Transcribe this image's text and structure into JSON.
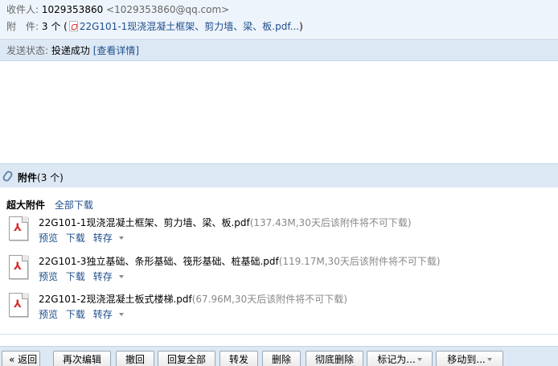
{
  "header": {
    "recipient_label": "收件人:",
    "recipient_name": "1029353860",
    "recipient_addr": "<1029353860@qq.com>",
    "attachment_label": "附　件:",
    "attachment_count": "3 个",
    "attachment_open": "(",
    "attachment_first": "22G101-1现浇混凝土框架、剪力墙、梁、板.pdf...",
    "attachment_close": ")"
  },
  "status": {
    "label": "发送状态:",
    "value": "投递成功",
    "detail_link": "[查看详情]"
  },
  "attachments": {
    "title": "附件",
    "count": "(3 个)",
    "section_label": "超大附件",
    "download_all": "全部下载",
    "items": [
      {
        "name": "22G101-1现浇混凝土框架、剪力墙、梁、板.pdf",
        "meta": "(137.43M,30天后该附件将不可下载)",
        "preview": "预览",
        "download": "下载",
        "save": "转存"
      },
      {
        "name": "22G101-3独立基础、条形基础、筏形基础、桩基础.pdf",
        "meta": "(119.17M,30天后该附件将不可下载)",
        "preview": "预览",
        "download": "下载",
        "save": "转存"
      },
      {
        "name": "22G101-2现浇混凝土板式楼梯.pdf",
        "meta": "(67.96M,30天后该附件将不可下载)",
        "preview": "预览",
        "download": "下载",
        "save": "转存"
      }
    ]
  },
  "toolbar": {
    "back": "« 返回",
    "re_edit": "再次编辑",
    "recall": "撤回",
    "reply_all": "回复全部",
    "forward": "转发",
    "delete": "删除",
    "perm_delete": "彻底删除",
    "mark_as": "标记为...",
    "move_to": "移动到..."
  }
}
